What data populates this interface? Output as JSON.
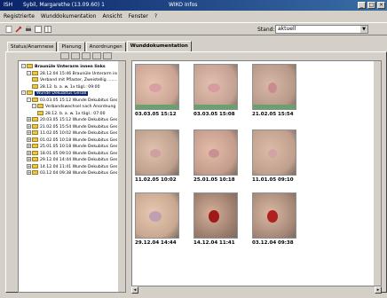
{
  "titlebar": {
    "app": "ISH",
    "user": "Sybil, Margarethe (13.09.60)  1",
    "center": "WIKO Infos"
  },
  "menu": [
    "Registrierte",
    "Wunddokumentation",
    "Ansicht",
    "Fenster",
    "?"
  ],
  "toolbar": {
    "stand_label": "Stand:",
    "stand_value": "aktuell"
  },
  "tabs": [
    "Status/Anamnese",
    "Planung",
    "Anordnungen",
    "Wunddokumentation"
  ],
  "tree": [
    {
      "level": 0,
      "exp": "-",
      "text": "Braunüle Unterarm innen links",
      "bold": true
    },
    {
      "level": 1,
      "exp": "-",
      "text": "28.12.04 15:46 Braunüle Unterarm innen links"
    },
    {
      "level": 2,
      "exp": "",
      "text": "Verband mit Pflaster, Zweistellig ......... 28.12..."
    },
    {
      "level": 2,
      "exp": "",
      "text": "28.12. b. a. w. 1x tägl.: 09:00"
    },
    {
      "level": 0,
      "exp": "-",
      "text": "Wunde Dekubitus Gesäß",
      "sel": true
    },
    {
      "level": 1,
      "exp": "-",
      "text": "03.03.05 15:12 Wunde Dekubitus Gesäß, Lok"
    },
    {
      "level": 2,
      "exp": "-",
      "text": "Verbandswechsel nach Anordnung"
    },
    {
      "level": 3,
      "exp": "",
      "text": "28.12. b. a. w. 1x tägl.: 07:00"
    },
    {
      "level": 1,
      "exp": "+",
      "text": "20.03.05 15:12 Wunde Dekubitus Gesäß, Lok"
    },
    {
      "level": 1,
      "exp": "+",
      "text": "21.02.05 15:54 Wunde Dekubitus Gesäß, Lok"
    },
    {
      "level": 1,
      "exp": "+",
      "text": "11.02.05 10:02 Wunde Dekubitus Gesäß, Lok"
    },
    {
      "level": 1,
      "exp": "+",
      "text": "01.02.05 10:18 Wunde Dekubitus Gesäß, Lok"
    },
    {
      "level": 1,
      "exp": "+",
      "text": "25.01.05 10:18 Wunde Dekubitus Gesäß, Lok"
    },
    {
      "level": 1,
      "exp": "+",
      "text": "18.01.05 09:10 Wunde Dekubitus Gesäß, Lok"
    },
    {
      "level": 1,
      "exp": "+",
      "text": "29.12.04 14:44 Wunde Dekubitus Gesäß, Lok"
    },
    {
      "level": 1,
      "exp": "+",
      "text": "14.12.04 11:41 Wunde Dekubitus Gesäß, Lok"
    },
    {
      "level": 1,
      "exp": "+",
      "text": "03.12.04 09:38 Wunde Dekubitus Gesäß, Lok"
    }
  ],
  "photos": [
    {
      "caption": "03.03.05 15:12"
    },
    {
      "caption": "03.03.05 15:08"
    },
    {
      "caption": "21.02.05 15:54"
    },
    {
      "caption": "11.02.05 10:02"
    },
    {
      "caption": "25.01.05 10:18"
    },
    {
      "caption": "11.01.05 09:10"
    },
    {
      "caption": "29.12.04 14:44"
    },
    {
      "caption": "14.12.04 11:41"
    },
    {
      "caption": "03.12.04 09:38"
    }
  ]
}
